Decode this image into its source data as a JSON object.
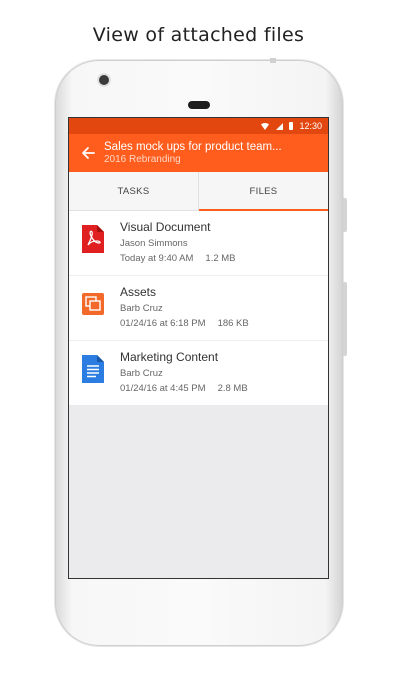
{
  "caption": "View of attached files",
  "status_bar": {
    "time": "12:30",
    "icons": [
      "wifi-icon",
      "signal-icon",
      "battery-icon"
    ]
  },
  "app_bar": {
    "title": "Sales mock ups for product team...",
    "subtitle": "2016 Rebranding",
    "back_icon": "arrow-left-icon"
  },
  "tabs": [
    {
      "label": "TASKS",
      "active": false
    },
    {
      "label": "FILES",
      "active": true
    }
  ],
  "files": [
    {
      "name": "Visual Document",
      "owner": "Jason Simmons",
      "date": "Today at 9:40 AM",
      "size": "1.2 MB",
      "icon": "pdf-icon",
      "color": "#e02020"
    },
    {
      "name": "Assets",
      "owner": "Barb Cruz",
      "date": "01/24/16 at 6:18 PM",
      "size": "186 KB",
      "icon": "slides-icon",
      "color": "#f2692a"
    },
    {
      "name": "Marketing Content",
      "owner": "Barb Cruz",
      "date": "01/24/16 at 4:45 PM",
      "size": "2.8 MB",
      "icon": "document-icon",
      "color": "#2b7de1"
    }
  ],
  "colors": {
    "accent": "#fe5d1e",
    "status_bar": "#e34710"
  }
}
